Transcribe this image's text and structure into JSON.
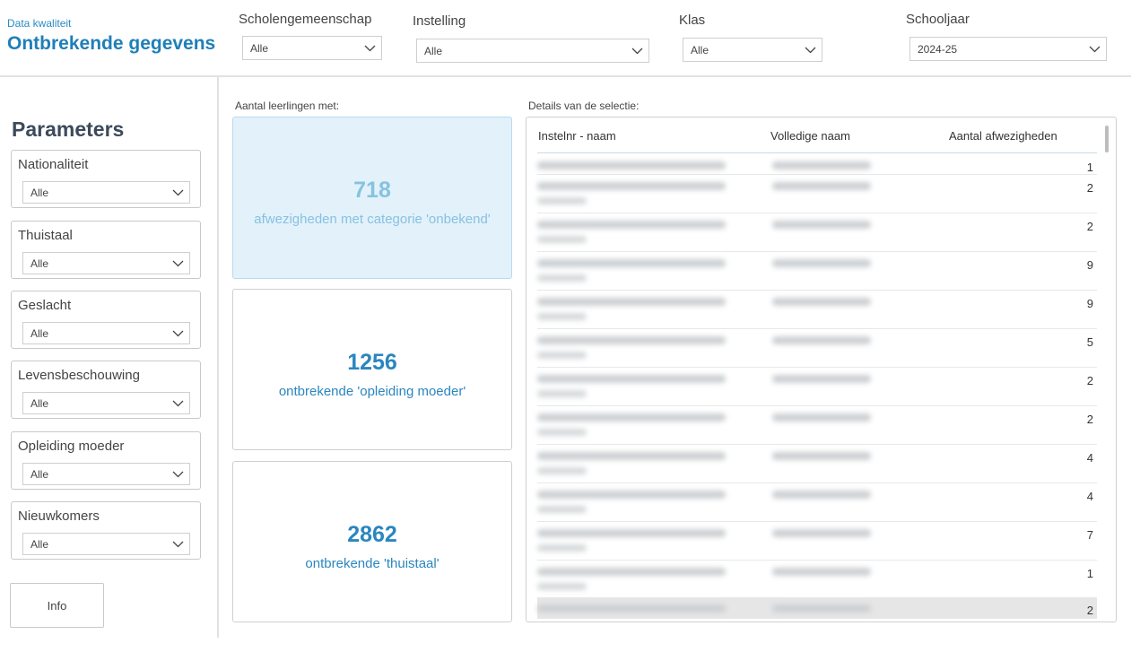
{
  "header": {
    "subtitle": "Data kwaliteit",
    "title": "Ontbrekende gegevens",
    "filters": [
      {
        "label": "Scholengemeenschap",
        "value": "Alle"
      },
      {
        "label": "Instelling",
        "value": "Alle"
      },
      {
        "label": "Klas",
        "value": "Alle"
      },
      {
        "label": "Schooljaar",
        "value": "2024-25"
      }
    ]
  },
  "parameters": {
    "title": "Parameters",
    "items": [
      {
        "label": "Nationaliteit",
        "value": "Alle"
      },
      {
        "label": "Thuistaal",
        "value": "Alle"
      },
      {
        "label": "Geslacht",
        "value": "Alle"
      },
      {
        "label": "Levensbeschouwing",
        "value": "Alle"
      },
      {
        "label": "Opleiding moeder",
        "value": "Alle"
      },
      {
        "label": "Nieuwkomers",
        "value": "Alle"
      }
    ],
    "info_label": "Info"
  },
  "kpis": {
    "section_label": "Aantal leerlingen met:",
    "cards": [
      {
        "value": "718",
        "description": "afwezigheden met categorie 'onbekend'"
      },
      {
        "value": "1256",
        "description": "ontbrekende 'opleiding moeder'"
      },
      {
        "value": "2862",
        "description": "ontbrekende 'thuistaal'"
      }
    ]
  },
  "details": {
    "section_label": "Details van de selectie:",
    "columns": [
      "Instelnr - naam",
      "Volledige naam",
      "Aantal afwezigheden"
    ],
    "rows": [
      {
        "count": "1"
      },
      {
        "count": "2"
      },
      {
        "count": "2"
      },
      {
        "count": "9"
      },
      {
        "count": "9"
      },
      {
        "count": "5"
      },
      {
        "count": "2"
      },
      {
        "count": "2"
      },
      {
        "count": "4"
      },
      {
        "count": "4"
      },
      {
        "count": "7"
      },
      {
        "count": "1"
      },
      {
        "count": "2"
      }
    ]
  },
  "icons": {
    "dropdown": "chevron-down-icon"
  }
}
